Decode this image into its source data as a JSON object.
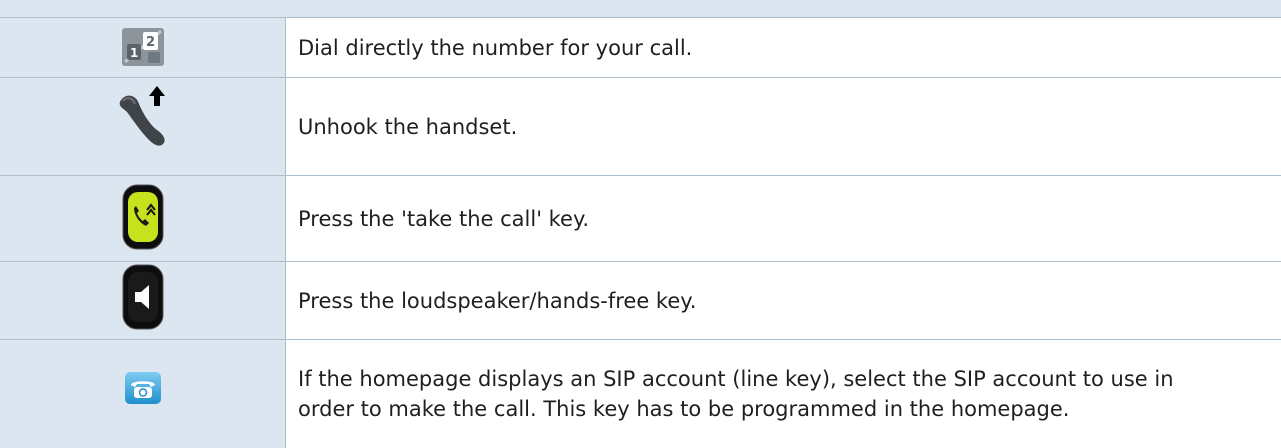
{
  "rows": [
    {
      "icon": "keypad-icon",
      "text": "Dial directly the number for your call."
    },
    {
      "icon": "handset-unhook-icon",
      "text": "Unhook the handset."
    },
    {
      "icon": "take-call-key-icon",
      "text": "Press the 'take the call' key."
    },
    {
      "icon": "loudspeaker-key-icon",
      "text": "Press the loudspeaker/hands-free key."
    },
    {
      "icon": "sip-line-key-icon",
      "text": "If the homepage displays an SIP account (line key), select the SIP account to use in order to make the call. This key has to be programmed in the homepage."
    }
  ],
  "colors": {
    "icon_column_bg": "#dce6f1",
    "border": "#aebdcc",
    "take_call_green": "#c6e21d",
    "sip_blue": "#3aa7df"
  }
}
